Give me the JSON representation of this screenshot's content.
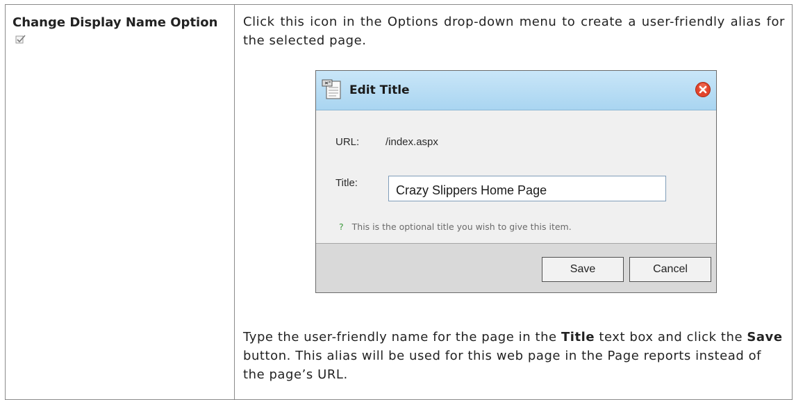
{
  "row": {
    "option_title": "Change Display Name Option",
    "option_icon": "edit-checkbox-icon",
    "description": "Click this icon in the Options drop-down menu to create a user-friendly alias for the selected page.",
    "instructions": {
      "part1": "Type the user-friendly name for the page in the ",
      "bold1": "Title",
      "part2": " text box and click the ",
      "bold2": "Save",
      "part3": " button.  This alias will be used for this web page in the Page reports instead of the page’s URL."
    }
  },
  "dialog": {
    "title": "Edit Title",
    "title_icon": "document-edit-icon",
    "close_icon": "close-icon",
    "accent_color": "#b9def5",
    "url_label": "URL:",
    "url_value": "/index.aspx",
    "title_label": "Title:",
    "title_value": "Crazy Slippers Home Page",
    "hint_mark": "?",
    "hint_text": "This is the optional title you wish to give this item.",
    "save_label": "Save",
    "cancel_label": "Cancel"
  }
}
